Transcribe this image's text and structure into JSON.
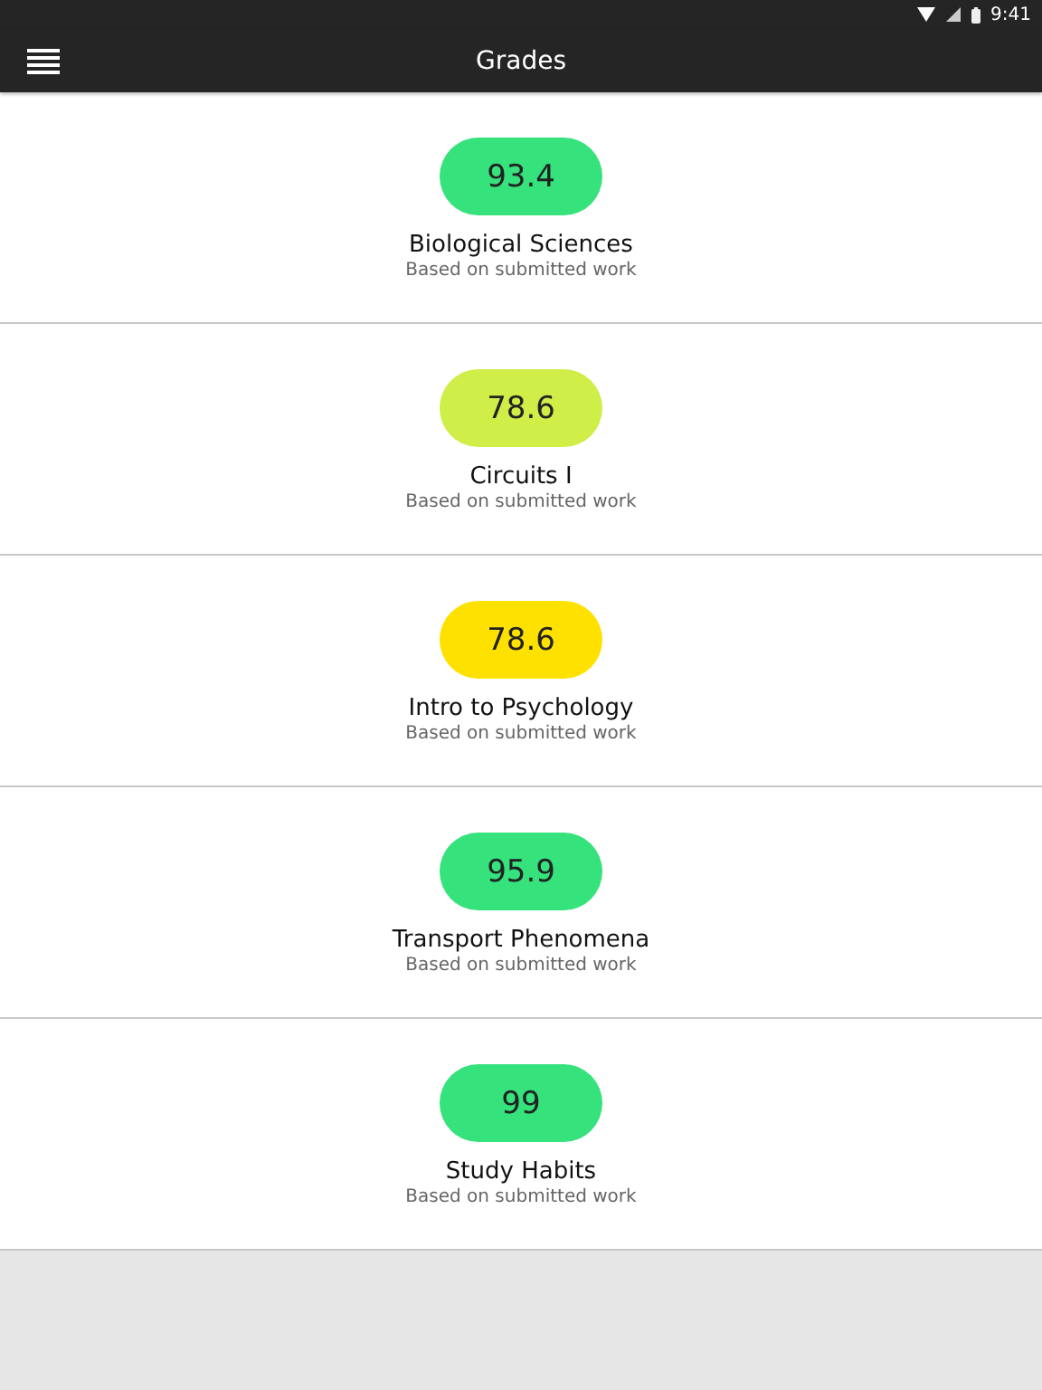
{
  "status_bar": {
    "time": "9:41"
  },
  "app_bar": {
    "title": "Grades"
  },
  "courses": [
    {
      "grade": "93.4",
      "color": "#35e27c",
      "name": "Biological Sciences",
      "note": "Based on submitted work"
    },
    {
      "grade": "78.6",
      "color": "#cfee47",
      "name": "Circuits I",
      "note": "Based on submitted work"
    },
    {
      "grade": "78.6",
      "color": "#ffe100",
      "name": "Intro to Psychology",
      "note": "Based on submitted work"
    },
    {
      "grade": "95.9",
      "color": "#35e27c",
      "name": "Transport Phenomena",
      "note": "Based on submitted work"
    },
    {
      "grade": "99",
      "color": "#35e27c",
      "name": "Study Habits",
      "note": "Based on submitted work"
    }
  ]
}
